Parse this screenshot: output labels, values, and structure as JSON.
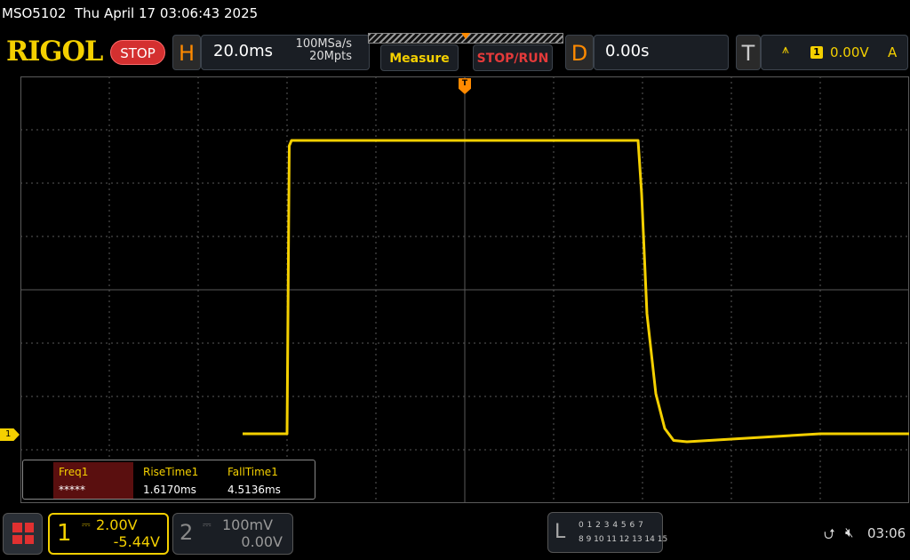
{
  "status": {
    "model": "MSO5102",
    "datetime": "Thu April 17 03:06:43 2025"
  },
  "header": {
    "brand": "RIGOL",
    "run_state": "STOP",
    "horizontal": {
      "letter": "H",
      "timebase": "20.0ms",
      "sample_rate": "100MSa/s",
      "memory_depth": "20Mpts"
    },
    "measure_label": "Measure",
    "stoprun_label": "STOP/RUN",
    "delay": {
      "letter": "D",
      "value": "0.00s"
    },
    "trigger": {
      "letter": "T",
      "source": "1",
      "level": "0.00V",
      "mode": "A"
    }
  },
  "colors": {
    "ch1": "#f4d000",
    "accent_orange": "#ff8a00",
    "stop_red": "#d43030",
    "grid": "#5a5a5a"
  },
  "waveform": {
    "channel": "1",
    "volts_per_div": 2.0,
    "offset_v": -5.44,
    "time_per_div_ms": 20,
    "points": [
      [
        -50,
        0.0
      ],
      [
        -40,
        0.0
      ],
      [
        -39.5,
        10.8
      ],
      [
        -39,
        11.0
      ],
      [
        0,
        11.0
      ],
      [
        39,
        11.0
      ],
      [
        39.8,
        9.0
      ],
      [
        41,
        4.5
      ],
      [
        43,
        1.5
      ],
      [
        45,
        0.2
      ],
      [
        47,
        -0.25
      ],
      [
        50,
        -0.3
      ],
      [
        60,
        -0.2
      ],
      [
        80,
        0.0
      ],
      [
        100,
        0.0
      ]
    ]
  },
  "measurements": [
    {
      "name": "Freq1",
      "value": "*****"
    },
    {
      "name": "RiseTime1",
      "value": "1.6170ms"
    },
    {
      "name": "FallTime1",
      "value": "4.5136ms"
    }
  ],
  "footer": {
    "ch1": {
      "num": "1",
      "scale": "2.00V",
      "offset": "-5.44V"
    },
    "ch2": {
      "num": "2",
      "scale": "100mV",
      "offset": "0.00V"
    },
    "la": {
      "letter": "L",
      "row1": "0 1 2 3  4 5 6 7",
      "row2": "8 9 10 11 12 13 14 15"
    },
    "time": "03:06"
  }
}
